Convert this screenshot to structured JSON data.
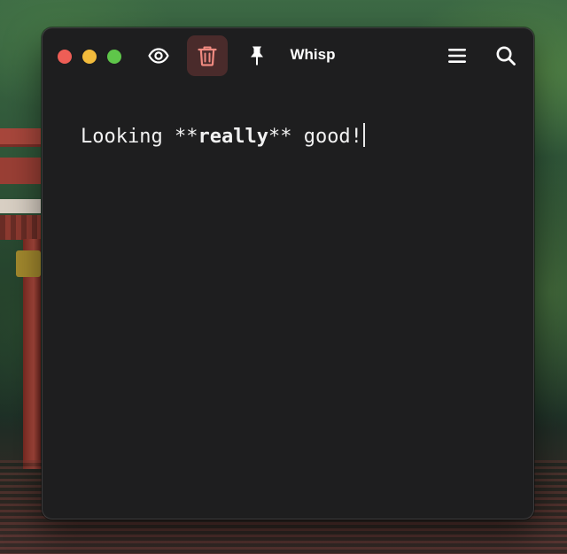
{
  "window": {
    "title": "Whisp"
  },
  "toolbar": {
    "buttons": [
      {
        "name": "preview",
        "icon": "eye-icon"
      },
      {
        "name": "delete",
        "icon": "trash-icon",
        "active": true,
        "accent": "#f08a80"
      },
      {
        "name": "pin",
        "icon": "pin-icon"
      },
      {
        "name": "menu",
        "icon": "hamburger-menu-icon"
      },
      {
        "name": "search",
        "icon": "search-icon"
      }
    ]
  },
  "editor": {
    "text_before": "Looking ",
    "bold_marker_open": "**",
    "bold_word": "really",
    "bold_marker_close": "**",
    "text_after": " good!"
  },
  "colors": {
    "window_bg": "#1e1e1f",
    "close": "#ee5e56",
    "minimize": "#f2bb3c",
    "maximize": "#5fc64a",
    "trash_accent": "#f08a80",
    "trash_bg": "#4a2b2b"
  }
}
